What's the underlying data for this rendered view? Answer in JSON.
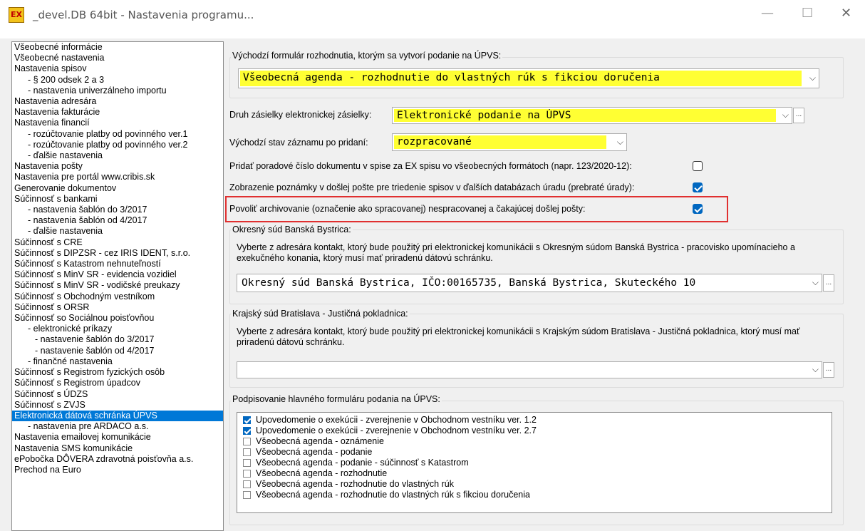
{
  "window": {
    "title": "_devel.DB 64bit - Nastavenia programu...",
    "app_icon_text": "EX",
    "minimize": "—",
    "maximize": "☐",
    "close": "✕"
  },
  "nav": {
    "items": [
      {
        "label": "Všeobecné informácie",
        "level": 1
      },
      {
        "label": "Všeobecné nastavenia",
        "level": 1
      },
      {
        "label": "Nastavenia spisov",
        "level": 1
      },
      {
        "label": "- § 200 odsek 2 a 3",
        "level": 2
      },
      {
        "label": "- nastavenia univerzálneho importu",
        "level": 2
      },
      {
        "label": "Nastavenia adresára",
        "level": 1
      },
      {
        "label": "Nastavenia fakturácie",
        "level": 1
      },
      {
        "label": "Nastavenia financií",
        "level": 1
      },
      {
        "label": "- rozúčtovanie platby od povinného ver.1",
        "level": 2
      },
      {
        "label": "- rozúčtovanie platby od povinného ver.2",
        "level": 2
      },
      {
        "label": "- ďalšie nastavenia",
        "level": 2
      },
      {
        "label": "Nastavenia pošty",
        "level": 1
      },
      {
        "label": "Nastavenia pre portál www.cribis.sk",
        "level": 1
      },
      {
        "label": "Generovanie dokumentov",
        "level": 1
      },
      {
        "label": "Súčinnosť s bankami",
        "level": 1
      },
      {
        "label": "- nastavenia šablón do 3/2017",
        "level": 2
      },
      {
        "label": "- nastavenia šablón od 4/2017",
        "level": 2
      },
      {
        "label": "- ďalšie nastavenia",
        "level": 2
      },
      {
        "label": "Súčinnosť s CRE",
        "level": 1
      },
      {
        "label": "Súčinnosť s DIPZSR - cez IRIS IDENT, s.r.o.",
        "level": 1
      },
      {
        "label": "Súčinnosť s Katastrom nehnuteľností",
        "level": 1
      },
      {
        "label": "Súčinnosť s MinV SR - evidencia vozidiel",
        "level": 1
      },
      {
        "label": "Súčinnosť s MinV SR - vodičské preukazy",
        "level": 1
      },
      {
        "label": "Súčinnosť s Obchodným vestníkom",
        "level": 1
      },
      {
        "label": "Súčinnosť s ORSR",
        "level": 1
      },
      {
        "label": "Súčinnosť so Sociálnou poisťovňou",
        "level": 1
      },
      {
        "label": "- elektronické príkazy",
        "level": 2
      },
      {
        "label": "- nastavenie šablón do 3/2017",
        "level": 3
      },
      {
        "label": "- nastavenie šablón od 4/2017",
        "level": 3
      },
      {
        "label": "- finančné nastavenia",
        "level": 2
      },
      {
        "label": "Súčinnosť s Registrom fyzických osôb",
        "level": 1
      },
      {
        "label": "Súčinnosť s Registrom úpadcov",
        "level": 1
      },
      {
        "label": "Súčinnosť s ÚDZS",
        "level": 1
      },
      {
        "label": "Súčinnosť s ZVJS",
        "level": 1
      },
      {
        "label": "Elektronická dátová schránka ÚPVS",
        "level": 1,
        "selected": true
      },
      {
        "label": "- nastavenia pre ARDACO a.s.",
        "level": 2
      },
      {
        "label": "Nastavenia emailovej komunikácie",
        "level": 1
      },
      {
        "label": "Nastavenia SMS komunikácie",
        "level": 1
      },
      {
        "label": "ePobočka DÔVERA zdravotná poisťovňa a.s.",
        "level": 1
      },
      {
        "label": "Prechod na Euro",
        "level": 1
      }
    ]
  },
  "form": {
    "default_form_label": "Východzí formulár rozhodnutia, ktorým sa vytvorí podanie na ÚPVS:",
    "default_form_value": "Všeobecná agenda - rozhodnutie do vlastných rúk s fikciou doručenia",
    "shipment_type_label": "Druh zásielky elektronickej zásielky:",
    "shipment_type_value": "Elektronické podanie na ÚPVS",
    "default_state_label": "Východzí stav záznamu po pridaní:",
    "default_state_value": "rozpracované",
    "add_order_label": "Pridať poradové číslo dokumentu v spise za EX spisu vo všeobecných formátoch (napr. 123/2020-12):",
    "add_order_checked": false,
    "show_note_label": "Zobrazenie poznámky v došlej pošte pre triedenie spisov v ďalších databázach úradu (prebraté úrady):",
    "show_note_checked": true,
    "allow_archive_label": "Povoliť archivovanie (označenie ako spracovanej) nespracovanej a čakajúcej došlej pošty:",
    "allow_archive_checked": true,
    "dots": "..."
  },
  "district_court": {
    "title": "Okresný súd Banská Bystrica:",
    "description": "Vyberte z adresára kontakt, ktorý bude použitý pri elektronickej komunikácii s Okresným súdom Banská Bystrica - pracovisko upomínacieho a exekučného konania, ktorý musí mať priradenú dátovú schránku.",
    "value": "Okresný súd Banská Bystrica, IČO:00165735, Banská Bystrica, Skuteckého 10"
  },
  "regional_court": {
    "title": "Krajský súd Bratislava - Justičná pokladnica:",
    "description": "Vyberte z adresára kontakt, ktorý bude použitý pri elektronickej komunikácii s Krajským súdom Bratislava - Justičná pokladnica, ktorý musí mať priradenú dátovú schránku.",
    "value": ""
  },
  "signing": {
    "title": "Podpisovanie hlavného formuláru podania na ÚPVS:",
    "items": [
      {
        "label": "Upovedomenie o exekúcii - zverejnenie v Obchodnom vestníku ver. 1.2",
        "checked": true
      },
      {
        "label": "Upovedomenie o exekúcii - zverejnenie v Obchodnom vestníku ver. 2.7",
        "checked": true
      },
      {
        "label": "Všeobecná agenda - oznámenie",
        "checked": false
      },
      {
        "label": "Všeobecná agenda - podanie",
        "checked": false
      },
      {
        "label": "Všeobecná agenda - podanie - súčinnosť s Katastrom",
        "checked": false
      },
      {
        "label": "Všeobecná agenda - rozhodnutie",
        "checked": false
      },
      {
        "label": "Všeobecná agenda - rozhodnutie do vlastných rúk",
        "checked": false
      },
      {
        "label": "Všeobecná agenda - rozhodnutie do vlastných rúk s fikciou doručenia",
        "checked": false
      }
    ]
  },
  "colors": {
    "highlight_yellow": "#ffff33",
    "selection_blue": "#0078d7",
    "checkbox_blue": "#0067c0",
    "annotation_red": "#e03030"
  }
}
